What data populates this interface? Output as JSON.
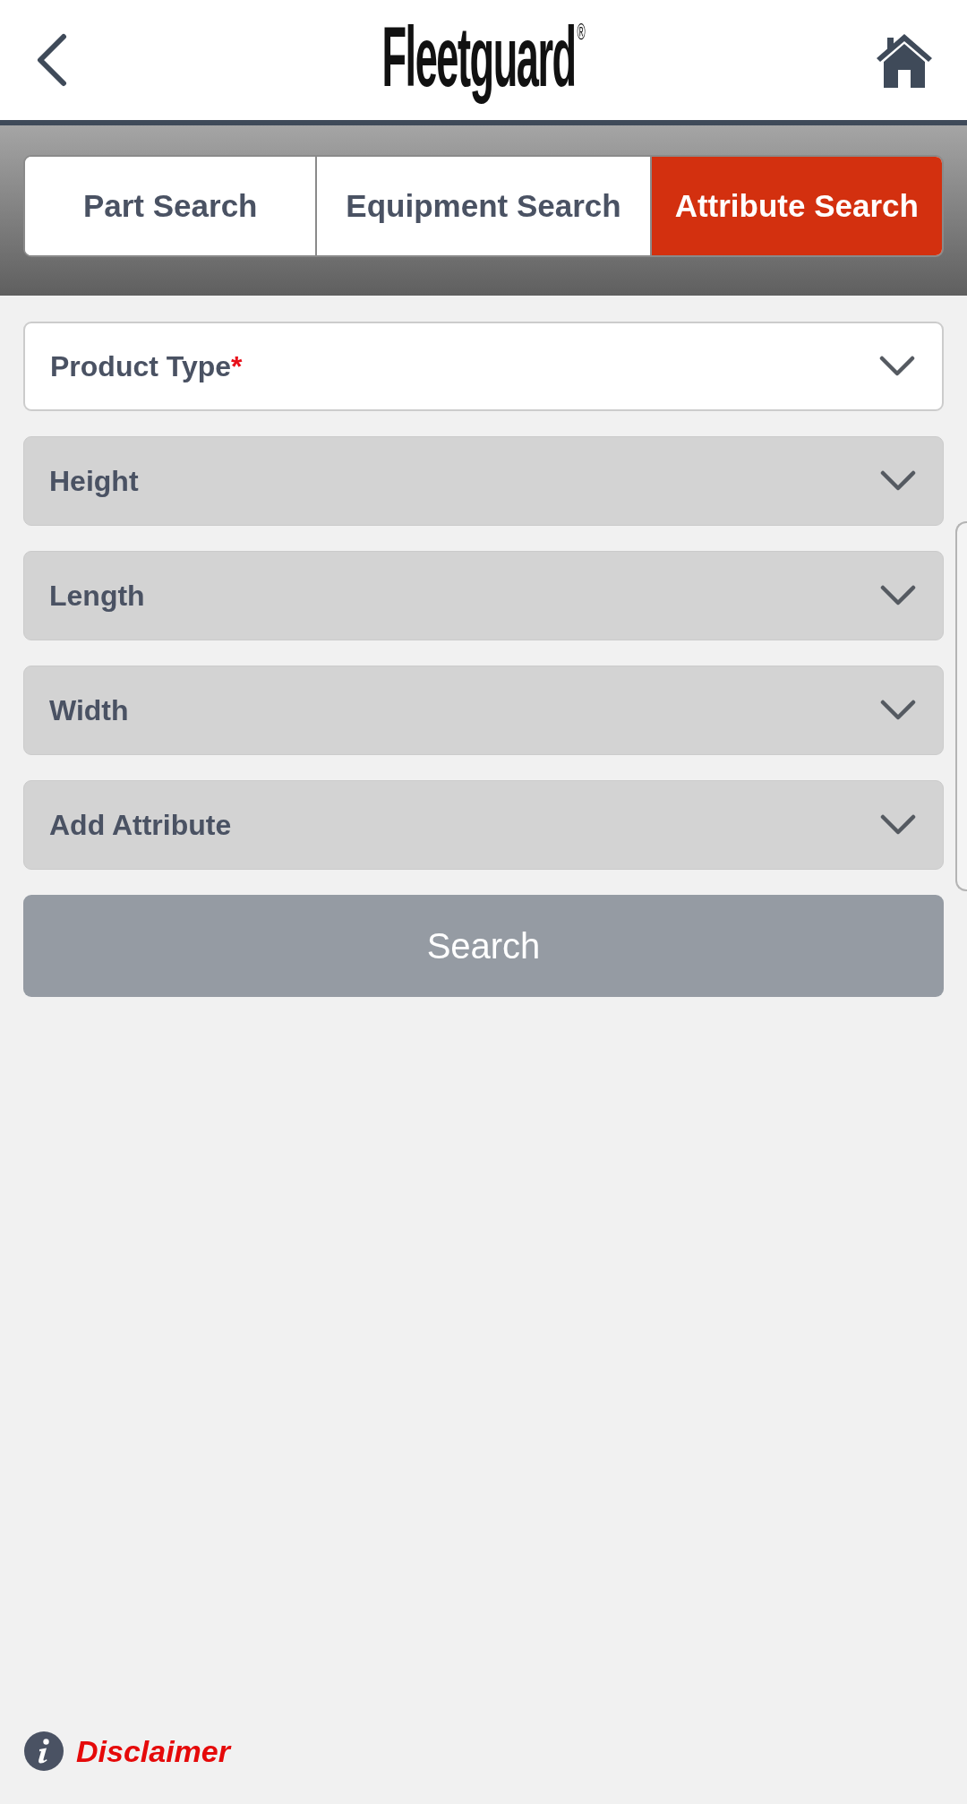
{
  "header": {
    "logo": "Fleetguard$^{®}$"
  },
  "tabs": [
    {
      "label": "Part Search",
      "selected": false
    },
    {
      "label": "Equipment Search",
      "selected": false
    },
    {
      "label": "Attribute Search",
      "selected": true
    }
  ],
  "filters": [
    {
      "label": "Product Type",
      "required_mark": "*",
      "disabled": false
    },
    {
      "label": "Height",
      "disabled": true
    },
    {
      "label": "Length",
      "disabled": true
    },
    {
      "label": "Width",
      "disabled": true
    },
    {
      "label": "Add Attribute",
      "disabled": true
    }
  ],
  "search_button": {
    "label": "Search",
    "disabled": true
  },
  "footer": {
    "link": "Disclaimer"
  }
}
